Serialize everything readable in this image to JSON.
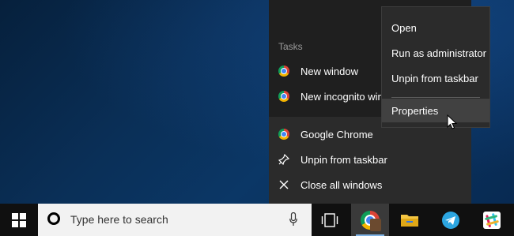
{
  "jumplist": {
    "tasks_title": "Tasks",
    "tasks": [
      {
        "label": "New window",
        "icon": "chrome-icon"
      },
      {
        "label": "New incognito window",
        "icon": "chrome-icon"
      }
    ],
    "app": {
      "label": "Google Chrome",
      "icon": "chrome-icon"
    },
    "actions": [
      {
        "label": "Unpin from taskbar",
        "icon": "unpin-icon"
      },
      {
        "label": "Close all windows",
        "icon": "close-icon"
      }
    ]
  },
  "context_menu": {
    "items": [
      "Open",
      "Run as administrator",
      "Unpin from taskbar"
    ],
    "properties": "Properties",
    "hovered": "Properties"
  },
  "taskbar": {
    "search_placeholder": "Type here to search",
    "apps": [
      "chrome-icon",
      "file-explorer-icon",
      "telegram-icon",
      "slack-icon"
    ],
    "active_app": "chrome-icon"
  },
  "colors": {
    "taskbar": "#101010",
    "jumplist": "#1f1f1f",
    "context_menu": "#2b2b2b",
    "hover": "#414141",
    "accent": "#7fb3e6"
  }
}
